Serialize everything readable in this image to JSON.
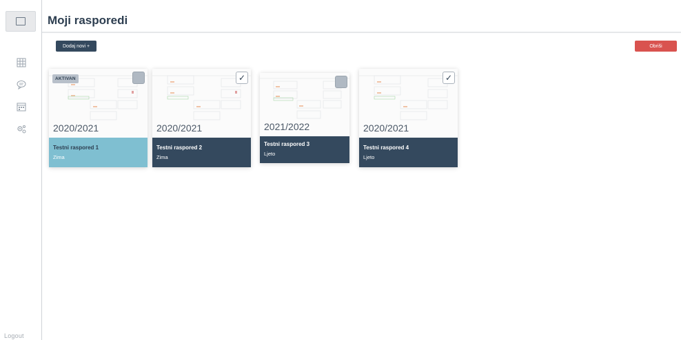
{
  "header": {
    "title": "Moji rasporedi"
  },
  "toolbar": {
    "add_label": "Dodaj novi +",
    "delete_label": "Obriši"
  },
  "sidebar": {
    "logout_label": "Logout"
  },
  "schedules": [
    {
      "year": "2020/2021",
      "name": "Testni raspored 1",
      "season": "Zima",
      "active": true,
      "active_label": "AKTIVAN",
      "checked": false,
      "footer_color": "#7fbfd1"
    },
    {
      "year": "2020/2021",
      "name": "Testni raspored 2",
      "season": "Zima",
      "active": false,
      "checked": true,
      "footer_color": "#34495e"
    },
    {
      "year": "2021/2022",
      "name": "Testni raspored 3",
      "season": "Ljeto",
      "active": false,
      "checked": false,
      "footer_color": "#34495e"
    },
    {
      "year": "2020/2021",
      "name": "Testni raspored 4",
      "season": "Ljeto",
      "active": false,
      "checked": true,
      "footer_color": "#34495e"
    }
  ],
  "colors": {
    "accent_dark": "#34495e",
    "accent_active": "#7fbfd1",
    "danger": "#d9534f"
  }
}
